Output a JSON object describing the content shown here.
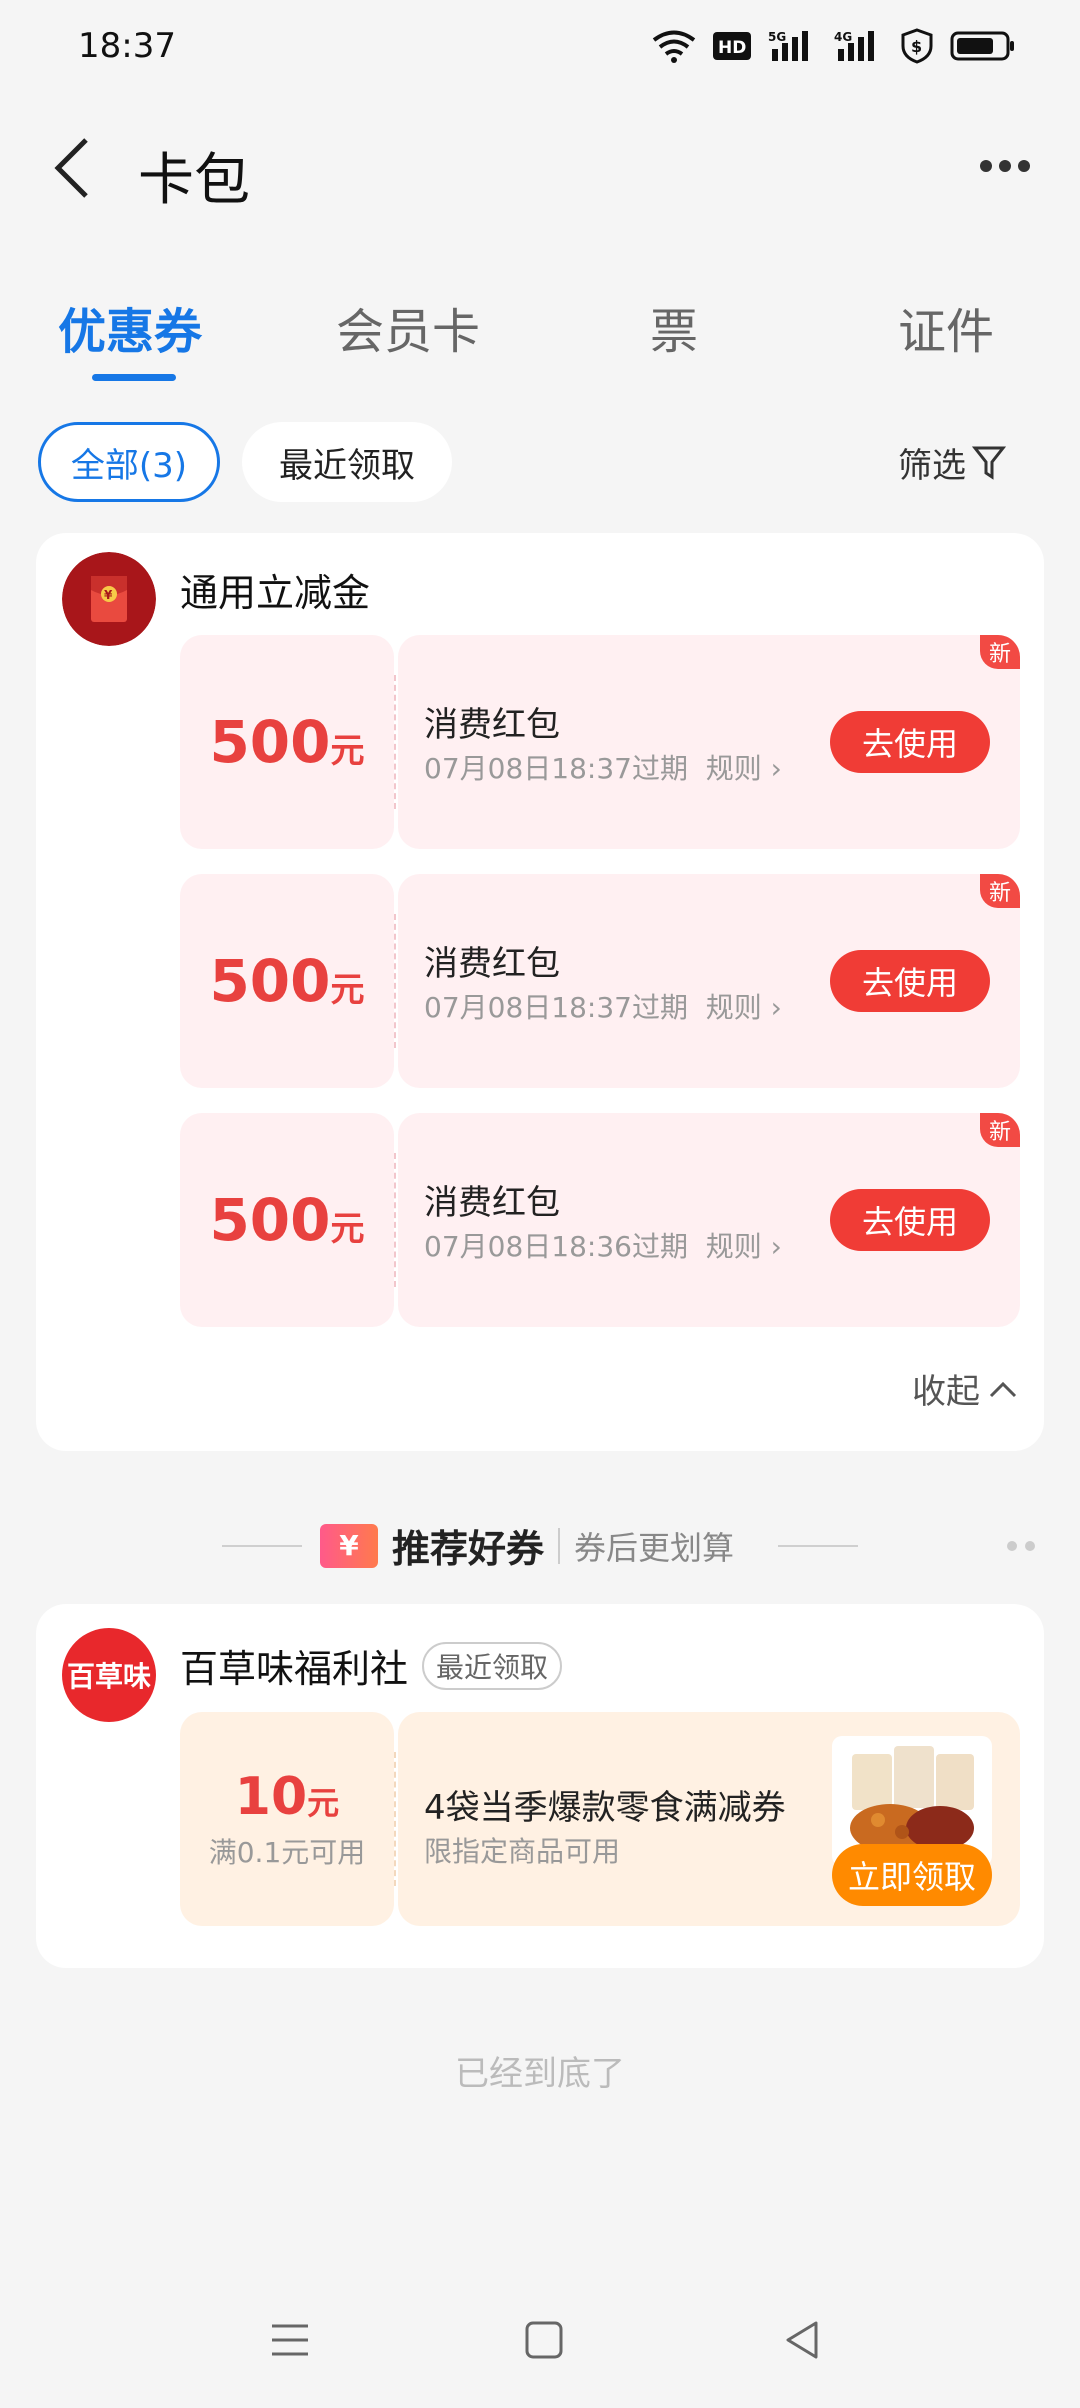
{
  "status": {
    "time": "18:37"
  },
  "header": {
    "title": "卡包"
  },
  "tabs": [
    {
      "label": "优惠券",
      "active": true
    },
    {
      "label": "会员卡",
      "active": false
    },
    {
      "label": "票",
      "active": false
    },
    {
      "label": "证件",
      "active": false
    }
  ],
  "filters": {
    "all": "全部(3)",
    "recent": "最近领取",
    "filter": "筛选"
  },
  "group1": {
    "title": "通用立减金",
    "coupons": [
      {
        "amount": "500",
        "unit": "元",
        "name": "消费红包",
        "expire": "07月08日18:37过期",
        "rule": "规则",
        "action": "去使用",
        "badge": "新"
      },
      {
        "amount": "500",
        "unit": "元",
        "name": "消费红包",
        "expire": "07月08日18:37过期",
        "rule": "规则",
        "action": "去使用",
        "badge": "新"
      },
      {
        "amount": "500",
        "unit": "元",
        "name": "消费红包",
        "expire": "07月08日18:36过期",
        "rule": "规则",
        "action": "去使用",
        "badge": "新"
      }
    ],
    "collapse": "收起"
  },
  "recommend": {
    "ticket": "¥",
    "title": "推荐好券",
    "subtitle": "券后更划算"
  },
  "group2": {
    "logo_text": "百草味",
    "title": "百草味福利社",
    "tag": "最近领取",
    "coupon": {
      "amount": "10",
      "unit": "元",
      "min": "满0.1元可用",
      "name": "4袋当季爆款零食满减券",
      "desc": "限指定商品可用",
      "action": "立即领取"
    }
  },
  "footer": {
    "end_text": "已经到底了"
  },
  "colors": {
    "accent": "#1677e6",
    "red": "#f03c36",
    "orange": "#ff8a00"
  }
}
